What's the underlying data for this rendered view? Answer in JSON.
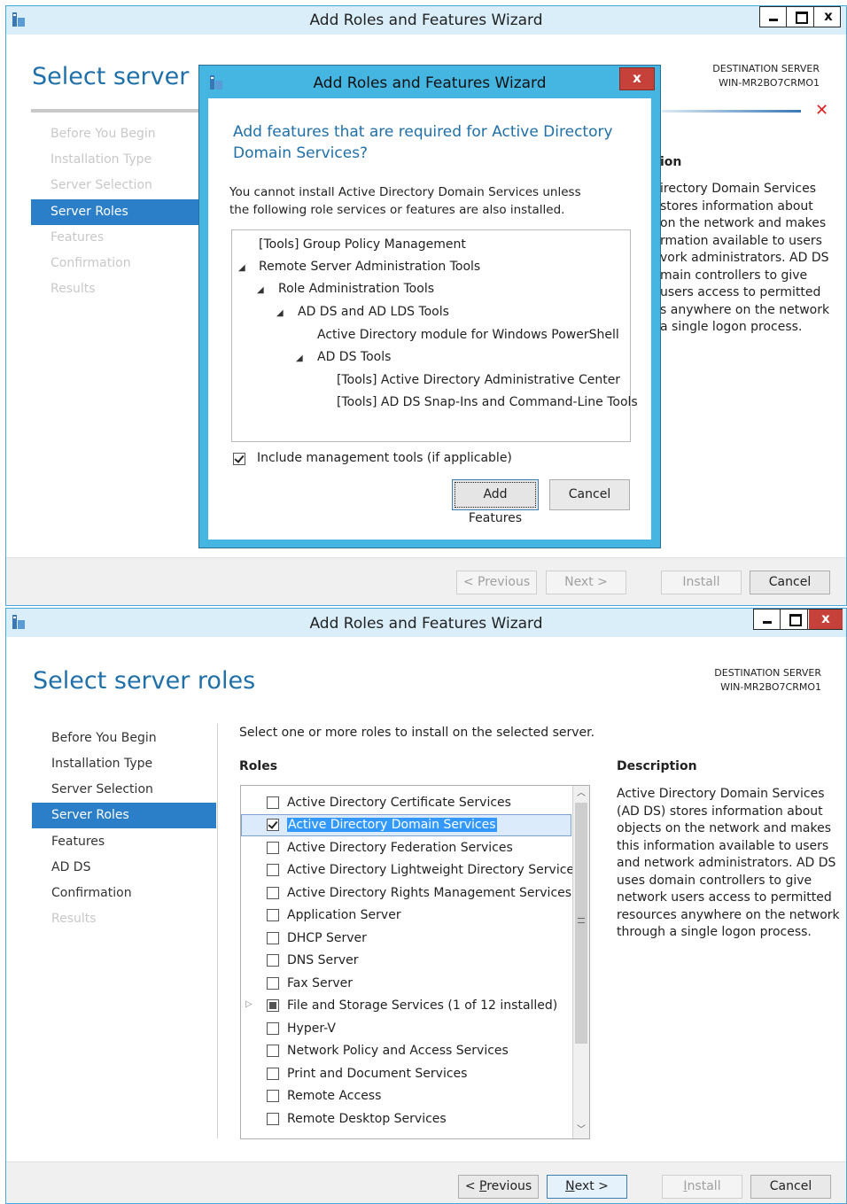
{
  "top_window": {
    "title": "Add Roles and Features Wizard",
    "page_title": "Select server ro",
    "destination_label": "DESTINATION SERVER",
    "destination_server": "WIN-MR2BO7CRMO1",
    "nav": [
      "Before You Begin",
      "Installation Type",
      "Server Selection",
      "Server Roles",
      "Features",
      "Confirmation",
      "Results"
    ],
    "partial_heading": "ion",
    "partial_description": [
      "irectory Domain Services",
      "stores information about",
      "on the network and makes",
      "rmation available to users",
      "vork administrators. AD DS",
      "main controllers to give",
      "users access to permitted",
      "s anywhere on the network",
      "a single logon process."
    ],
    "buttons": {
      "previous": "< Previous",
      "next": "Next >",
      "install": "Install",
      "cancel": "Cancel"
    }
  },
  "dialog": {
    "title": "Add Roles and Features Wizard",
    "heading": "Add features that are required for Active Directory Domain Services?",
    "message": "You cannot install Active Directory Domain Services unless the following role services or features are also installed.",
    "tree": [
      "[Tools] Group Policy Management",
      "Remote Server Administration Tools",
      "Role Administration Tools",
      "AD DS and AD LDS Tools",
      "Active Directory module for Windows PowerShell",
      "AD DS Tools",
      "[Tools] Active Directory Administrative Center",
      "[Tools] AD DS Snap-Ins and Command-Line Tools"
    ],
    "include_tools_label": "Include management tools (if applicable)",
    "include_tools_checked": true,
    "add_features": "Add Features",
    "cancel": "Cancel"
  },
  "bottom_window": {
    "title": "Add Roles and Features Wizard",
    "page_title": "Select server roles",
    "destination_label": "DESTINATION SERVER",
    "destination_server": "WIN-MR2BO7CRMO1",
    "nav": [
      "Before You Begin",
      "Installation Type",
      "Server Selection",
      "Server Roles",
      "Features",
      "AD DS",
      "Confirmation",
      "Results"
    ],
    "instruction": "Select one or more roles to install on the selected server.",
    "roles_heading": "Roles",
    "roles": [
      {
        "label": "Active Directory Certificate Services",
        "state": "unchecked"
      },
      {
        "label": "Active Directory Domain Services",
        "state": "checked"
      },
      {
        "label": "Active Directory Federation Services",
        "state": "unchecked"
      },
      {
        "label": "Active Directory Lightweight Directory Services",
        "state": "unchecked"
      },
      {
        "label": "Active Directory Rights Management Services",
        "state": "unchecked"
      },
      {
        "label": "Application Server",
        "state": "unchecked"
      },
      {
        "label": "DHCP Server",
        "state": "unchecked"
      },
      {
        "label": "DNS Server",
        "state": "unchecked"
      },
      {
        "label": "Fax Server",
        "state": "unchecked"
      },
      {
        "label": "File and Storage Services (1 of 12 installed)",
        "state": "partial"
      },
      {
        "label": "Hyper-V",
        "state": "unchecked"
      },
      {
        "label": "Network Policy and Access Services",
        "state": "unchecked"
      },
      {
        "label": "Print and Document Services",
        "state": "unchecked"
      },
      {
        "label": "Remote Access",
        "state": "unchecked"
      },
      {
        "label": "Remote Desktop Services",
        "state": "unchecked"
      }
    ],
    "description_heading": "Description",
    "description_lines": [
      "Active Directory Domain Services",
      "(AD DS) stores information about",
      "objects on the network and makes",
      "this information available to users",
      "and network administrators. AD DS",
      "uses domain controllers to give",
      "network users access to permitted",
      "resources anywhere on the network",
      "through a single logon process."
    ],
    "buttons": {
      "previous_prefix": "< ",
      "previous_key": "P",
      "previous_rest": "revious",
      "next_key": "N",
      "next_rest": "ext >",
      "install_key": "I",
      "install_rest": "nstall",
      "cancel": "Cancel"
    }
  },
  "colors": {
    "accent": "#2b7fc9",
    "title_bar": "#d9eef9",
    "dialog_frame": "#45b5e2",
    "error_x": "#e02020"
  }
}
